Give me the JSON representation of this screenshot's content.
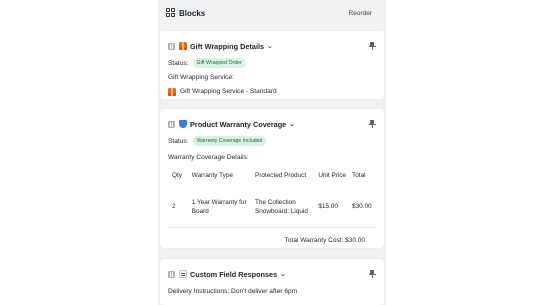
{
  "header": {
    "title": "Blocks",
    "reorder_label": "Reorder"
  },
  "gift_card": {
    "title": "Gift Wrapping Details",
    "status_label": "Status:",
    "status_badge": "Gift Wrapped Order",
    "service_label": "Gift Wrapping Service:",
    "service_value": "Gift Wrapping Service - Standard"
  },
  "warranty_card": {
    "title": "Product Warranty Coverage",
    "status_label": "Status:",
    "status_badge": "Warranty Coverage Included",
    "details_label": "Warranty Coverage Details:",
    "table": {
      "headers": [
        "Qty",
        "Warranty Type",
        "Protected Product",
        "Unit Price",
        "Total"
      ],
      "row": {
        "qty": "2",
        "type_line1": "1 Year Warranty for",
        "type_line2": "Board",
        "product_line1": "The Collection",
        "product_line2": "Snowboard: Liquid",
        "unit_price": "$15.00",
        "total": "$30.00"
      }
    },
    "total_label": "Total Warranty Cost: $30.00"
  },
  "custom_card": {
    "title": "Custom Field Responses",
    "delivery_text": "Delivery Instructions: Don't deliver after 6pm"
  },
  "icons": {
    "blocks": "blocks-icon",
    "drag": "drag-handle-icon",
    "gift": "gift-icon",
    "shield": "shield-icon",
    "memo": "memo-icon",
    "pin": "pin-icon",
    "chevron": "chevron-down-icon"
  },
  "colors": {
    "badge_bg": "#d9f2e3",
    "badge_text": "#1a6b3b",
    "panel_bg": "#f1f2f4"
  }
}
